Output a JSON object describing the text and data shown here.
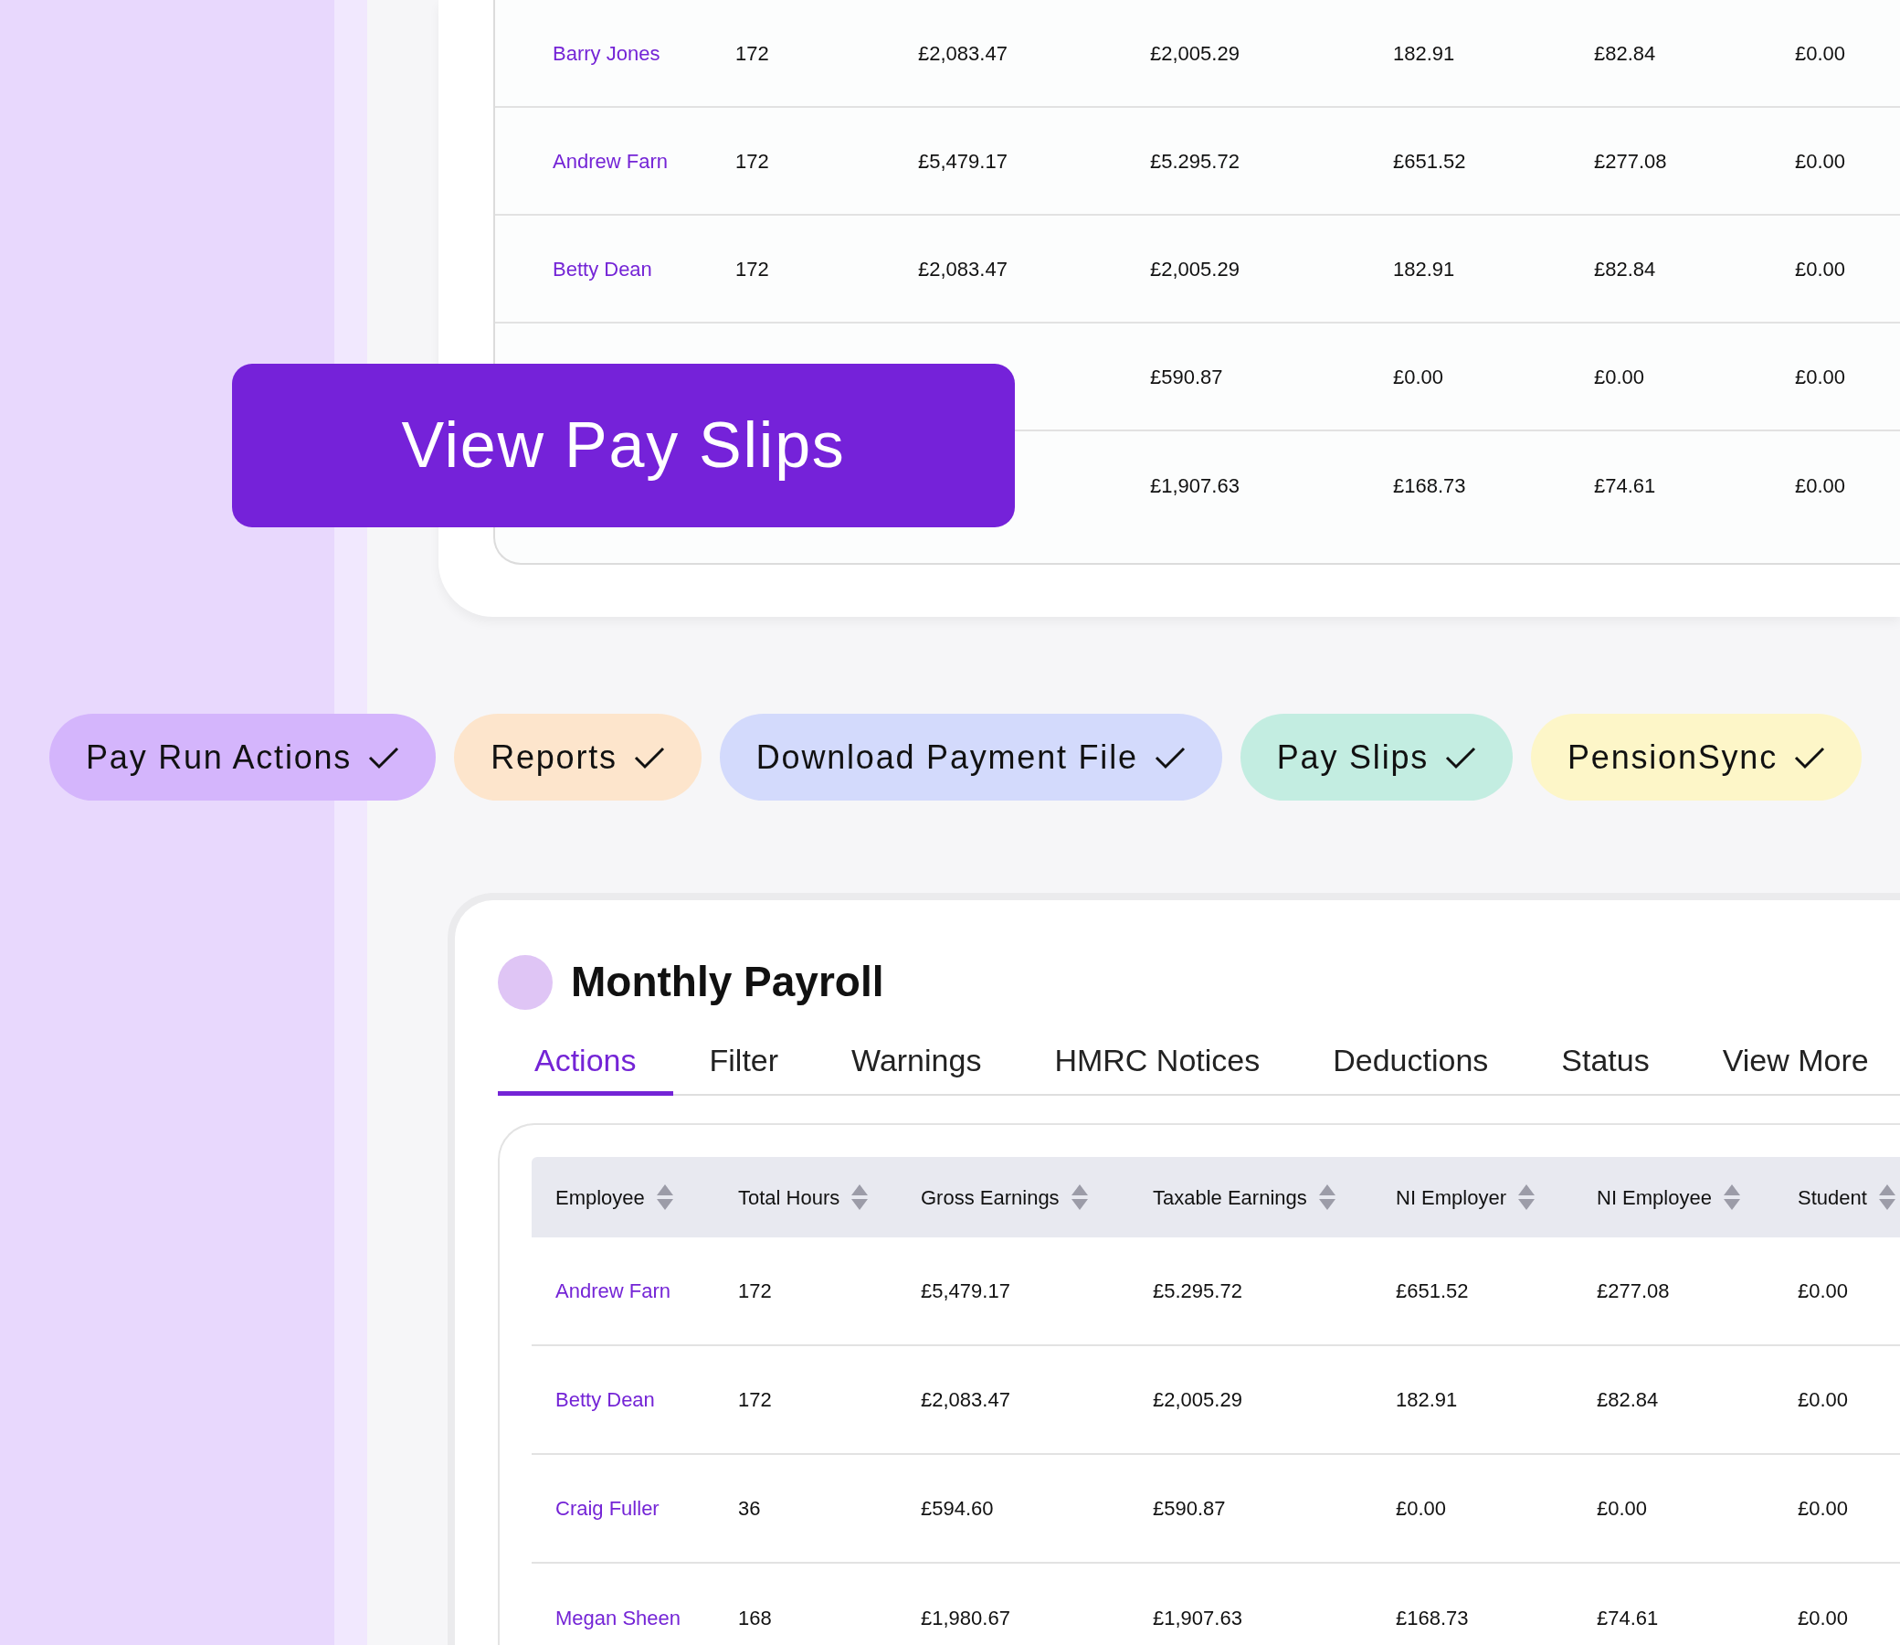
{
  "top_table": {
    "rows": [
      {
        "cells": [
          "Barry Jones",
          "172",
          "£2,083.47",
          "£2,005.29",
          "182.91",
          "£82.84",
          "£0.00"
        ]
      },
      {
        "cells": [
          "Andrew Farn",
          "172",
          "£5,479.17",
          "£5.295.72",
          "£651.52",
          "£277.08",
          "£0.00"
        ]
      },
      {
        "cells": [
          "Betty Dean",
          "172",
          "£2,083.47",
          "£2,005.29",
          "182.91",
          "£82.84",
          "£0.00"
        ]
      },
      {
        "cells": [
          "£590.87",
          "£0.00",
          "£0.00",
          "£0.00"
        ]
      },
      {
        "cells": [
          "£1,907.63",
          "£168.73",
          "£74.61",
          "£0.00"
        ]
      }
    ]
  },
  "view_button": {
    "label": "View Pay Slips"
  },
  "action_pills": [
    {
      "label": "Pay Run Actions",
      "color": "#d4b5fc"
    },
    {
      "label": "Reports",
      "color": "#fde5cc"
    },
    {
      "label": "Download Payment File",
      "color": "#d3dafc"
    },
    {
      "label": "Pay Slips",
      "color": "#c3ede1"
    },
    {
      "label": "PensionSync",
      "color": "#fdf6c8"
    }
  ],
  "payroll": {
    "title": "Monthly Payroll",
    "tabs": [
      {
        "label": "Actions",
        "selected": true
      },
      {
        "label": "Filter",
        "selected": false
      },
      {
        "label": "Warnings",
        "selected": false
      },
      {
        "label": "HMRC Notices",
        "selected": false
      },
      {
        "label": "Deductions",
        "selected": false
      },
      {
        "label": "Status",
        "selected": false
      },
      {
        "label": "View More",
        "selected": false
      }
    ],
    "table": {
      "columns": [
        "Employee",
        "Total Hours",
        "Gross Earnings",
        "Taxable Earnings",
        "NI Employer",
        "NI Employee",
        "Student"
      ],
      "rows": [
        {
          "cells": [
            "Andrew Farn",
            "172",
            "£5,479.17",
            "£5.295.72",
            "£651.52",
            "£277.08",
            "£0.00"
          ]
        },
        {
          "cells": [
            "Betty Dean",
            "172",
            "£2,083.47",
            "£2,005.29",
            "182.91",
            "£82.84",
            "£0.00"
          ]
        },
        {
          "cells": [
            "Craig Fuller",
            "36",
            "£594.60",
            "£590.87",
            "£0.00",
            "£0.00",
            "£0.00"
          ]
        },
        {
          "cells": [
            "Megan Sheen",
            "168",
            "£1,980.67",
            "£1,907.63",
            "£168.73",
            "£74.61",
            "£0.00"
          ]
        }
      ]
    }
  }
}
